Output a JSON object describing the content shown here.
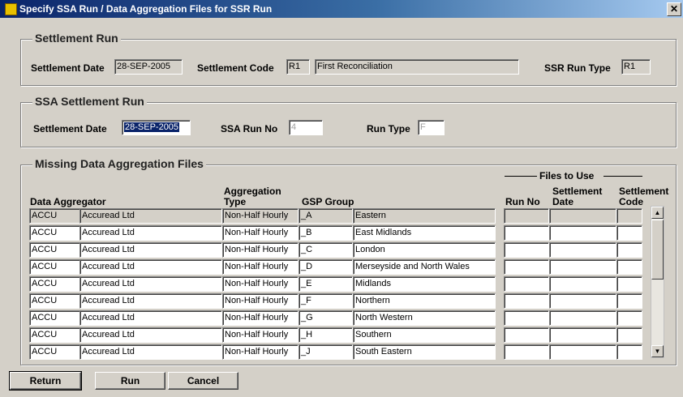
{
  "window": {
    "title": "Specify SSA Run / Data Aggregation Files for SSR Run",
    "close_glyph": "✕"
  },
  "settlement_run": {
    "legend": "Settlement Run",
    "date_label": "Settlement Date",
    "date_value": "28-SEP-2005",
    "code_label": "Settlement Code",
    "code_value": "R1",
    "code_desc": "First Reconciliation",
    "run_type_label": "SSR Run Type",
    "run_type_value": "R1"
  },
  "ssa_run": {
    "legend": "SSA Settlement Run",
    "date_label": "Settlement Date",
    "date_value": "28-SEP-2005",
    "run_no_label": "SSA Run No",
    "run_no_value": "4",
    "run_type_label": "Run Type",
    "run_type_value": "F"
  },
  "missing": {
    "legend": "Missing Data Aggregation Files",
    "files_to_use": "Files to Use",
    "headers": {
      "data_aggregator": "Data Aggregator",
      "aggregation_type_1": "Aggregation",
      "aggregation_type_2": "Type",
      "gsp_group": "GSP Group",
      "run_no": "Run No",
      "settlement_date_1": "Settlement",
      "settlement_date_2": "Date",
      "settlement_code_1": "Settlement",
      "settlement_code_2": "Code"
    },
    "rows": [
      {
        "code": "ACCU",
        "name": "Accuread Ltd",
        "type": "Non-Half Hourly",
        "gsp": "_A",
        "gsp_name": "Eastern",
        "run_no": "",
        "date": "",
        "scode": ""
      },
      {
        "code": "ACCU",
        "name": "Accuread Ltd",
        "type": "Non-Half Hourly",
        "gsp": "_B",
        "gsp_name": "East Midlands",
        "run_no": "",
        "date": "",
        "scode": ""
      },
      {
        "code": "ACCU",
        "name": "Accuread Ltd",
        "type": "Non-Half Hourly",
        "gsp": "_C",
        "gsp_name": "London",
        "run_no": "",
        "date": "",
        "scode": ""
      },
      {
        "code": "ACCU",
        "name": "Accuread Ltd",
        "type": "Non-Half Hourly",
        "gsp": "_D",
        "gsp_name": "Merseyside and North Wales",
        "run_no": "",
        "date": "",
        "scode": ""
      },
      {
        "code": "ACCU",
        "name": "Accuread Ltd",
        "type": "Non-Half Hourly",
        "gsp": "_E",
        "gsp_name": "Midlands",
        "run_no": "",
        "date": "",
        "scode": ""
      },
      {
        "code": "ACCU",
        "name": "Accuread Ltd",
        "type": "Non-Half Hourly",
        "gsp": "_F",
        "gsp_name": "Northern",
        "run_no": "",
        "date": "",
        "scode": ""
      },
      {
        "code": "ACCU",
        "name": "Accuread Ltd",
        "type": "Non-Half Hourly",
        "gsp": "_G",
        "gsp_name": "North Western",
        "run_no": "",
        "date": "",
        "scode": ""
      },
      {
        "code": "ACCU",
        "name": "Accuread Ltd",
        "type": "Non-Half Hourly",
        "gsp": "_H",
        "gsp_name": "Southern",
        "run_no": "",
        "date": "",
        "scode": ""
      },
      {
        "code": "ACCU",
        "name": "Accuread Ltd",
        "type": "Non-Half Hourly",
        "gsp": "_J",
        "gsp_name": "South Eastern",
        "run_no": "",
        "date": "",
        "scode": ""
      }
    ]
  },
  "scroll": {
    "up_glyph": "▲",
    "down_glyph": "▼"
  },
  "buttons": {
    "return": "Return",
    "run": "Run",
    "cancel": "Cancel"
  }
}
